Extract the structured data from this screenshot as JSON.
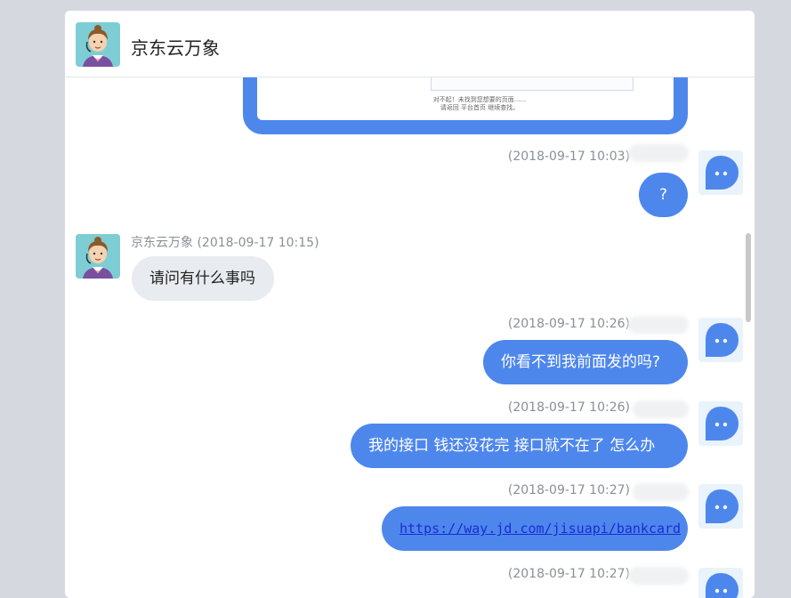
{
  "header": {
    "title": "京东云万象"
  },
  "image_caption": {
    "line1": "对不起！未找到您想要的页面......",
    "line2": "请返回 平台首页 继续查找。"
  },
  "messages": [
    {
      "meta": "(2018-09-17 10:03)",
      "text": "?"
    },
    {
      "meta": "京东云万象 (2018-09-17 10:15)",
      "text": "请问有什么事吗"
    },
    {
      "meta": "(2018-09-17 10:26)",
      "text": "你看不到我前面发的吗?"
    },
    {
      "meta": "(2018-09-17 10:26)",
      "text": "我的接口  钱还没花完  接口就不在了  怎么办"
    },
    {
      "meta": "(2018-09-17 10:27)",
      "text": "https://way.jd.com/jisuapi/bankcard"
    },
    {
      "meta": "(2018-09-17 10:27)"
    }
  ],
  "colors": {
    "outgoing": "#4e87ec",
    "incoming": "#e8ebef",
    "page_bg": "#d5d9df"
  }
}
